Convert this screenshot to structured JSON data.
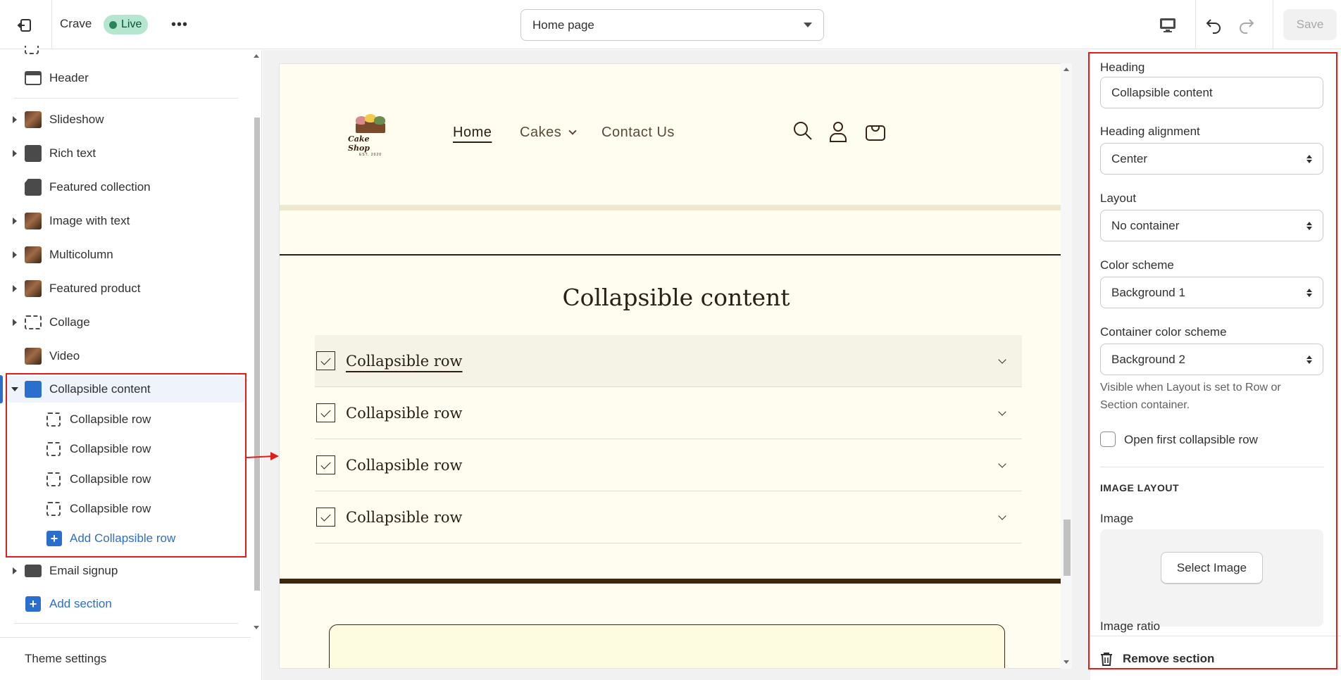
{
  "topbar": {
    "store_name": "Crave",
    "status_badge": "Live",
    "page_select": "Home page",
    "save_label": "Save"
  },
  "sidebar": {
    "items": [
      {
        "label": "Header"
      },
      {
        "label": "Slideshow"
      },
      {
        "label": "Rich text"
      },
      {
        "label": "Featured collection"
      },
      {
        "label": "Image with text"
      },
      {
        "label": "Multicolumn"
      },
      {
        "label": "Featured product"
      },
      {
        "label": "Collage"
      },
      {
        "label": "Video"
      },
      {
        "label": "Collapsible content"
      },
      {
        "label": "Email signup"
      }
    ],
    "sub_items": [
      {
        "label": "Collapsible row"
      },
      {
        "label": "Collapsible row"
      },
      {
        "label": "Collapsible row"
      },
      {
        "label": "Collapsible row"
      }
    ],
    "add_row": "Add Collapsible row",
    "add_section": "Add section",
    "theme_settings": "Theme settings"
  },
  "preview": {
    "logo_text": "Cake Shop",
    "logo_sub": "EST. 2020",
    "nav": {
      "home": "Home",
      "cakes": "Cakes",
      "contact": "Contact Us"
    },
    "section_title": "Collapsible content",
    "rows": [
      "Collapsible row",
      "Collapsible row",
      "Collapsible row",
      "Collapsible row"
    ]
  },
  "settings": {
    "heading_label": "Heading",
    "heading_value": "Collapsible content",
    "alignment_label": "Heading alignment",
    "alignment_value": "Center",
    "layout_label": "Layout",
    "layout_value": "No container",
    "color_label": "Color scheme",
    "color_value": "Background 1",
    "container_label": "Container color scheme",
    "container_value": "Background 2",
    "help_text": "Visible when Layout is set to Row or Section container.",
    "open_first_label": "Open first collapsible row",
    "open_first_checked": false,
    "image_layout_heading": "IMAGE LAYOUT",
    "image_label": "Image",
    "select_image": "Select Image",
    "ratio_label": "Image ratio",
    "remove_section": "Remove section"
  },
  "colors": {
    "accent": "#2c6ecb",
    "annotation": "#e21b1b",
    "preview_bg": "#fffdf0",
    "brand_dark": "#3d2612"
  }
}
